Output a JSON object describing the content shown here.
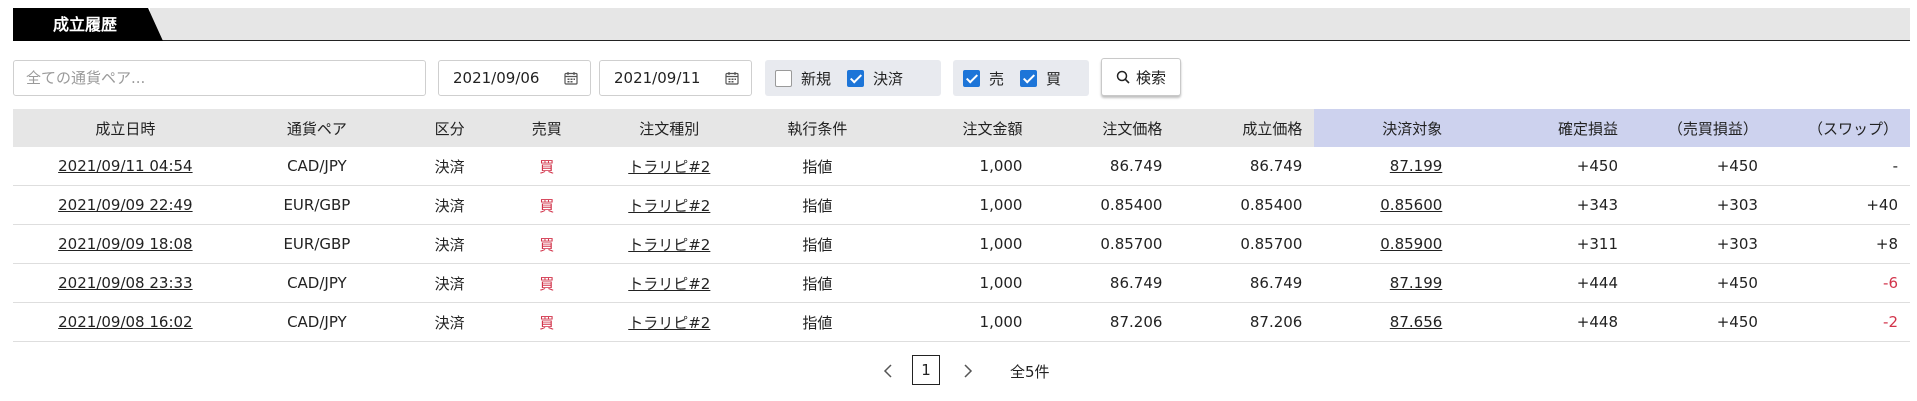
{
  "tab": {
    "title": "成立履歴"
  },
  "filters": {
    "pair_placeholder": "全ての通貨ペア...",
    "date_from": "2021/09/06",
    "date_to": "2021/09/11",
    "new_label": "新規",
    "new_checked": false,
    "settle_label": "決済",
    "settle_checked": true,
    "sell_label": "売",
    "sell_checked": true,
    "buy_label": "買",
    "buy_checked": true,
    "search_label": "検索"
  },
  "table": {
    "headers": [
      "成立日時",
      "通貨ペア",
      "区分",
      "売買",
      "注文種別",
      "執行条件",
      "注文金額",
      "注文価格",
      "成立価格",
      "決済対象",
      "確定損益",
      "（売買損益）",
      "（スワップ）"
    ],
    "rows": [
      {
        "datetime": "2021/09/11 04:54",
        "pair": "CAD/JPY",
        "kubun": "決済",
        "side": "買",
        "order_type": "トラリピ#2",
        "condition": "指値",
        "amount": "1,000",
        "order_price": "86.749",
        "fill_price": "86.749",
        "target": "87.199",
        "pnl": "+450",
        "trade_pnl": "+450",
        "swap": "-"
      },
      {
        "datetime": "2021/09/09 22:49",
        "pair": "EUR/GBP",
        "kubun": "決済",
        "side": "買",
        "order_type": "トラリピ#2",
        "condition": "指値",
        "amount": "1,000",
        "order_price": "0.85400",
        "fill_price": "0.85400",
        "target": "0.85600",
        "pnl": "+343",
        "trade_pnl": "+303",
        "swap": "+40"
      },
      {
        "datetime": "2021/09/09 18:08",
        "pair": "EUR/GBP",
        "kubun": "決済",
        "side": "買",
        "order_type": "トラリピ#2",
        "condition": "指値",
        "amount": "1,000",
        "order_price": "0.85700",
        "fill_price": "0.85700",
        "target": "0.85900",
        "pnl": "+311",
        "trade_pnl": "+303",
        "swap": "+8"
      },
      {
        "datetime": "2021/09/08 23:33",
        "pair": "CAD/JPY",
        "kubun": "決済",
        "side": "買",
        "order_type": "トラリピ#2",
        "condition": "指値",
        "amount": "1,000",
        "order_price": "86.749",
        "fill_price": "86.749",
        "target": "87.199",
        "pnl": "+444",
        "trade_pnl": "+450",
        "swap": "-6"
      },
      {
        "datetime": "2021/09/08 16:02",
        "pair": "CAD/JPY",
        "kubun": "決済",
        "side": "買",
        "order_type": "トラリピ#2",
        "condition": "指値",
        "amount": "1,000",
        "order_price": "87.206",
        "fill_price": "87.206",
        "target": "87.656",
        "pnl": "+448",
        "trade_pnl": "+450",
        "swap": "-2"
      }
    ]
  },
  "pager": {
    "current": "1",
    "total": "全5件"
  },
  "colors": {
    "accent": "#1d75d8",
    "negative": "#d2334a",
    "header_blue": "#cdd2ee"
  }
}
